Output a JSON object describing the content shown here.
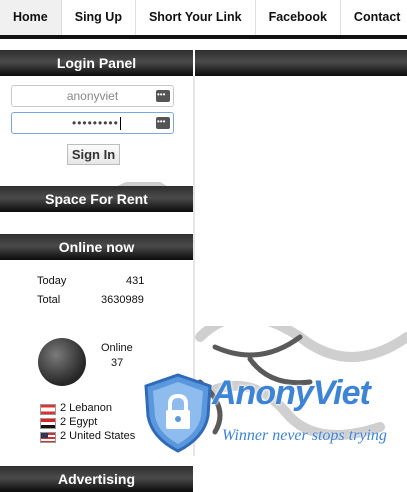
{
  "nav": {
    "items": [
      {
        "label": "Home",
        "active": true
      },
      {
        "label": "Sing Up",
        "active": false
      },
      {
        "label": "Short Your Link",
        "active": false
      },
      {
        "label": "Facebook",
        "active": false
      },
      {
        "label": "Contact",
        "active": false
      }
    ]
  },
  "login": {
    "title": "Login Panel",
    "username_value": "anonyviet",
    "password_value": "•••••••••",
    "signin_label": "Sign In"
  },
  "rent": {
    "title": "Space For Rent"
  },
  "online": {
    "title": "Online now",
    "today_label": "Today",
    "today_value": "431",
    "total_label": "Total",
    "total_value": "3630989",
    "online_label": "Online",
    "online_value": "37",
    "countries": [
      {
        "text": "2 Lebanon",
        "flag": "flag-lebanon-icon"
      },
      {
        "text": "2 Egypt",
        "flag": "flag-egypt-icon"
      },
      {
        "text": "2 United States",
        "flag": "flag-usa-icon"
      }
    ]
  },
  "advertising": {
    "title": "Advertising"
  },
  "watermark": {
    "title": "AnonyViet",
    "tagline": "Winner never stops trying",
    "icon": "shield-lock-icon",
    "color": "#3d83d6"
  }
}
